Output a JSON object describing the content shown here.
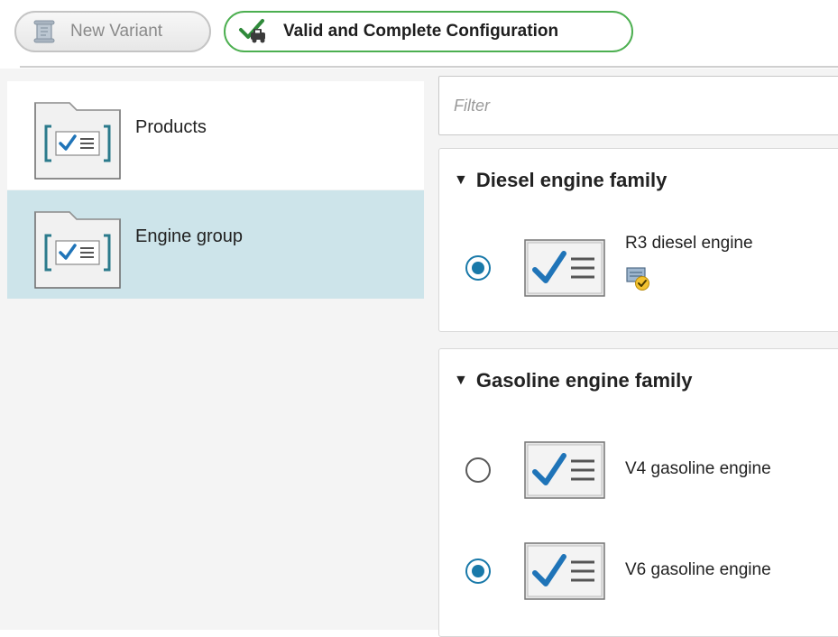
{
  "toolbar": {
    "new_variant_label": "New Variant",
    "valid_config_label": "Valid and Complete Configuration",
    "colors": {
      "valid_border": "#4caf50",
      "disabled_text": "#8a8a8a"
    }
  },
  "sidebar": {
    "items": [
      {
        "label": "Products",
        "icon": "folder-checklist-icon",
        "selected": false
      },
      {
        "label": "Engine group",
        "icon": "folder-checklist-icon",
        "selected": true
      }
    ],
    "colors": {
      "selected_bg": "#cde4ea"
    }
  },
  "main": {
    "filter": {
      "placeholder": "Filter",
      "value": ""
    },
    "groups": [
      {
        "title": "Diesel engine family",
        "expanded": true,
        "options": [
          {
            "label": "R3 diesel engine",
            "selected": true,
            "icon": "checklist-icon",
            "status_icon": "config-valid-badge-icon"
          }
        ]
      },
      {
        "title": "Gasoline engine family",
        "expanded": true,
        "options": [
          {
            "label": "V4 gasoline engine",
            "selected": false,
            "icon": "checklist-icon"
          },
          {
            "label": "V6 gasoline engine",
            "selected": true,
            "icon": "checklist-icon"
          }
        ]
      }
    ],
    "colors": {
      "radio_accent": "#1979a9"
    }
  }
}
